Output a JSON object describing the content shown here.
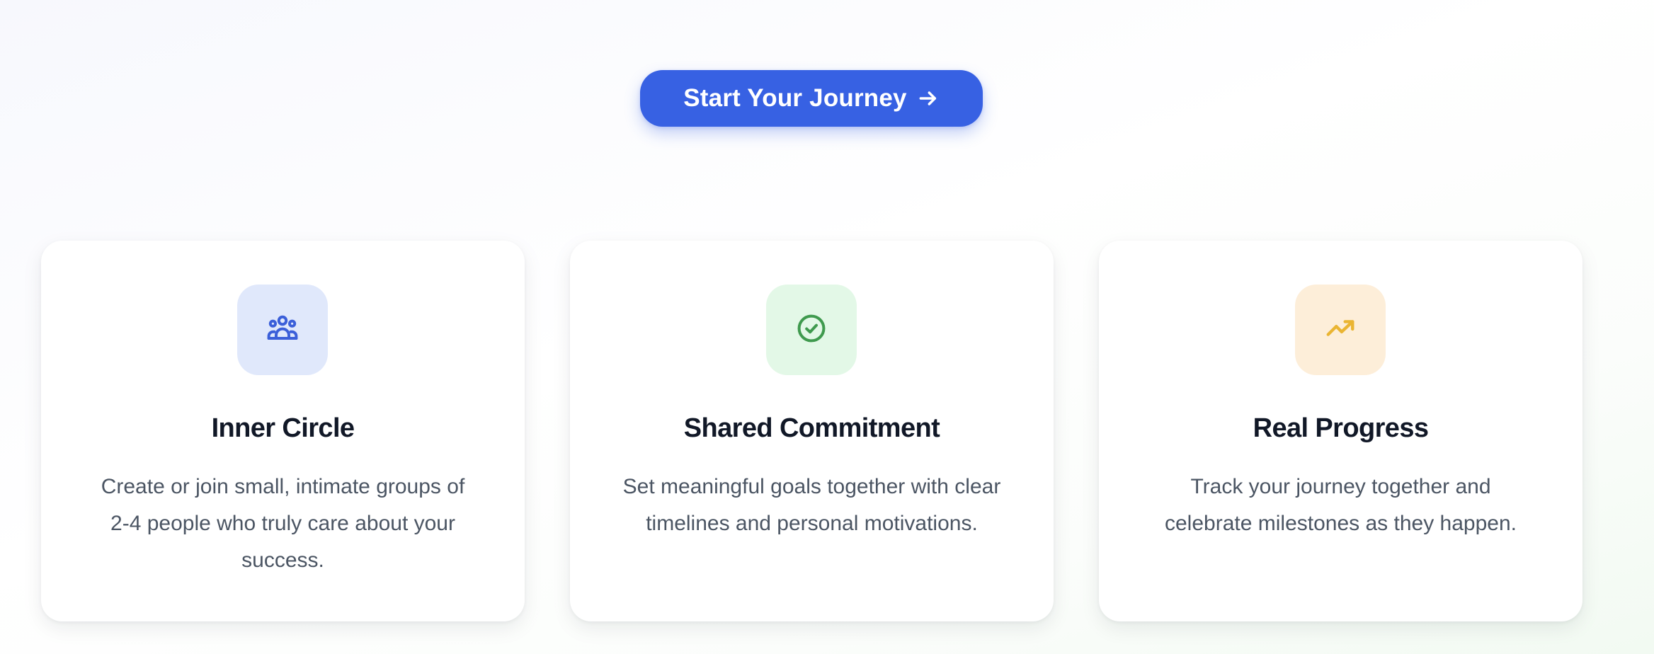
{
  "cta": {
    "label": "Start Your Journey",
    "arrow_icon": "arrow-right-icon",
    "color": "#3761e3"
  },
  "features": [
    {
      "icon": "users-group-icon",
      "icon_color": "#3b5fd9",
      "tile_color": "#e0e8fb",
      "title": "Inner Circle",
      "description": "Create or join small, intimate groups of 2-4 people who truly care about your success."
    },
    {
      "icon": "check-circle-icon",
      "icon_color": "#3f9a4e",
      "tile_color": "#e3f8e7",
      "title": "Shared Commitment",
      "description": "Set meaningful goals together with clear timelines and personal motivations."
    },
    {
      "icon": "trending-up-icon",
      "icon_color": "#eab533",
      "tile_color": "#fdeed9",
      "title": "Real Progress",
      "description": "Track your journey together and celebrate milestones as they happen."
    }
  ]
}
